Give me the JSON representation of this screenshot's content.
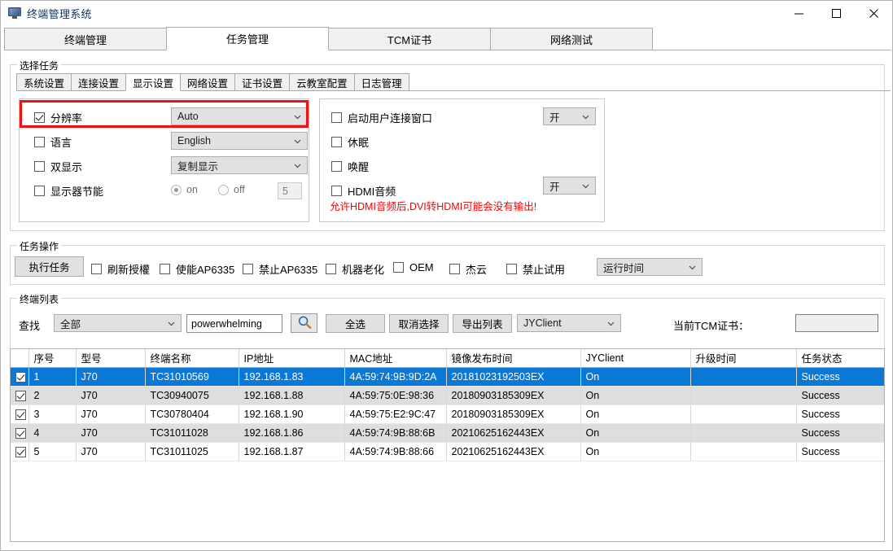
{
  "window": {
    "title": "终端管理系统",
    "icon": "monitor-icon",
    "minimize": "−",
    "maximize": "☐",
    "close": "✕"
  },
  "main_tabs": [
    {
      "label": "终端管理",
      "active": false
    },
    {
      "label": "任务管理",
      "active": true
    },
    {
      "label": "TCM证书",
      "active": false
    },
    {
      "label": "网络测试",
      "active": false
    }
  ],
  "select_task": {
    "group_label": "选择任务",
    "sub_tabs": [
      {
        "label": "系统设置",
        "active": false
      },
      {
        "label": "连接设置",
        "active": false
      },
      {
        "label": "显示设置",
        "active": true
      },
      {
        "label": "网络设置",
        "active": false
      },
      {
        "label": "证书设置",
        "active": false
      },
      {
        "label": "云教室配置",
        "active": false
      },
      {
        "label": "日志管理",
        "active": false
      }
    ],
    "left_panel": {
      "resolution": {
        "label": "分辨率",
        "checked": true,
        "value": "Auto",
        "highlight_color": "#ee1111"
      },
      "language": {
        "label": "语言",
        "checked": false,
        "value": "English"
      },
      "dual_display": {
        "label": "双显示",
        "checked": false,
        "value": "复制显示"
      },
      "monitor_power_save": {
        "label": "显示器节能",
        "checked": false,
        "on_label": "on",
        "off_label": "off",
        "selected": "on",
        "minutes": "5"
      }
    },
    "right_panel": {
      "user_connect_window": {
        "label": "启动用户连接窗口",
        "checked": false,
        "value": "开"
      },
      "sleep": {
        "label": "休眠",
        "checked": false
      },
      "wake": {
        "label": "唤醒",
        "checked": false
      },
      "hdmi_audio": {
        "label": "HDMI音频",
        "checked": false,
        "value": "开"
      },
      "warning": "允许HDMI音频后,DVI转HDMI可能会没有输出!",
      "warning_color": "#ff0000"
    }
  },
  "task_ops": {
    "group_label": "任务操作",
    "execute_button": "执行任务",
    "checkboxes": [
      {
        "label": "刷新授權",
        "checked": false
      },
      {
        "label": "使能AP6335",
        "checked": false
      },
      {
        "label": "禁止AP6335",
        "checked": false
      },
      {
        "label": "机器老化",
        "checked": false
      },
      {
        "label": "OEM",
        "checked": false
      },
      {
        "label": "杰云",
        "checked": false
      },
      {
        "label": "禁止试用",
        "checked": false
      }
    ],
    "runtime_select": "运行时间"
  },
  "terminal_list": {
    "group_label": "终端列表",
    "find_label": "查找",
    "filter_select": "全部",
    "search_value": "powerwhelming",
    "search_placeholder": "",
    "search_icon": "magnifier-icon",
    "select_all_button": "全选",
    "deselect_button": "取消选择",
    "export_button": "导出列表",
    "client_select": "JYClient",
    "tcm_label": "当前TCM证书：",
    "tcm_value": "",
    "columns": [
      "序号",
      "型号",
      "终端名称",
      "IP地址",
      "MAC地址",
      "镜像发布时间",
      "JYClient",
      "升级时间",
      "任务状态"
    ],
    "rows": [
      {
        "checked": true,
        "selected": true,
        "seq": "1",
        "model": "J70",
        "name": "TC31010569",
        "ip": "192.168.1.83",
        "mac": "4A:59:74:9B:9D:2A",
        "image_time": "20181023192503EX",
        "jyclient": "On",
        "upgrade_time": "",
        "status": "Success"
      },
      {
        "checked": true,
        "selected": false,
        "seq": "2",
        "model": "J70",
        "name": "TC30940075",
        "ip": "192.168.1.88",
        "mac": "4A:59:75:0E:98:36",
        "image_time": "20180903185309EX",
        "jyclient": "On",
        "upgrade_time": "",
        "status": "Success"
      },
      {
        "checked": true,
        "selected": false,
        "seq": "3",
        "model": "J70",
        "name": "TC30780404",
        "ip": "192.168.1.90",
        "mac": "4A:59:75:E2:9C:47",
        "image_time": "20180903185309EX",
        "jyclient": "On",
        "upgrade_time": "",
        "status": "Success"
      },
      {
        "checked": true,
        "selected": false,
        "seq": "4",
        "model": "J70",
        "name": "TC31011028",
        "ip": "192.168.1.86",
        "mac": "4A:59:74:9B:88:6B",
        "image_time": "20210625162443EX",
        "jyclient": "On",
        "upgrade_time": "",
        "status": "Success"
      },
      {
        "checked": true,
        "selected": false,
        "seq": "5",
        "model": "J70",
        "name": "TC31011025",
        "ip": "192.168.1.87",
        "mac": "4A:59:74:9B:88:66",
        "image_time": "20210625162443EX",
        "jyclient": "On",
        "upgrade_time": "",
        "status": "Success"
      }
    ]
  },
  "colors": {
    "selection_blue": "#0a78d7",
    "success_green": "#267f26",
    "warning_red": "#ff0000",
    "highlight_red": "#ee1111",
    "title_blue": "#11305e"
  }
}
